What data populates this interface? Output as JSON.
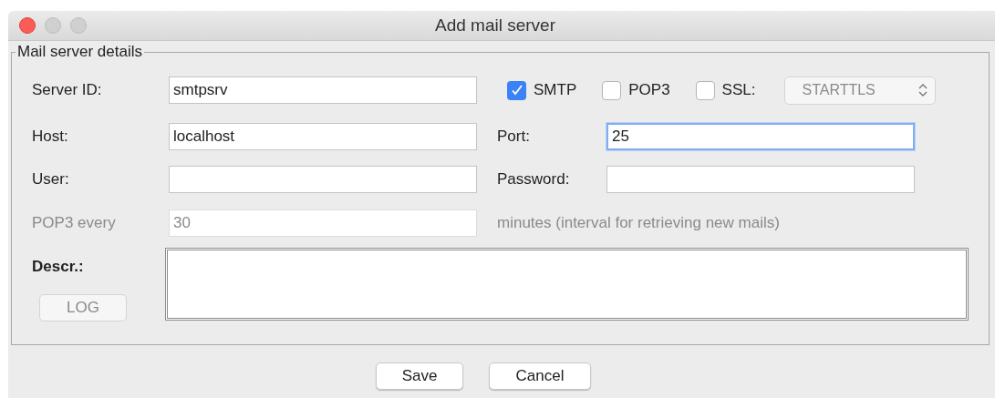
{
  "window": {
    "title": "Add mail server"
  },
  "group": {
    "title": "Mail server details"
  },
  "server_id": {
    "label": "Server ID:",
    "value": "smtpsrv"
  },
  "protocols": [
    {
      "label": "SMTP",
      "checked": true
    },
    {
      "label": "POP3",
      "checked": false
    },
    {
      "label": "SSL:",
      "checked": false
    }
  ],
  "ssl_mode": {
    "value": "STARTTLS",
    "disabled": true
  },
  "host": {
    "label": "Host:",
    "value": "localhost"
  },
  "port": {
    "label": "Port:",
    "value": "25",
    "focused": true
  },
  "user": {
    "label": "User:"
  },
  "password": {
    "label": "Password:"
  },
  "pop3_interval": {
    "label": "POP3 every",
    "value": "30",
    "unit": "minutes (interval for retrieving new mails)",
    "disabled": true
  },
  "description": {
    "label": "Descr.:"
  },
  "log_button": {
    "label": "LOG",
    "disabled": true
  },
  "buttons": [
    {
      "label": "Save"
    },
    {
      "label": "Cancel"
    }
  ]
}
